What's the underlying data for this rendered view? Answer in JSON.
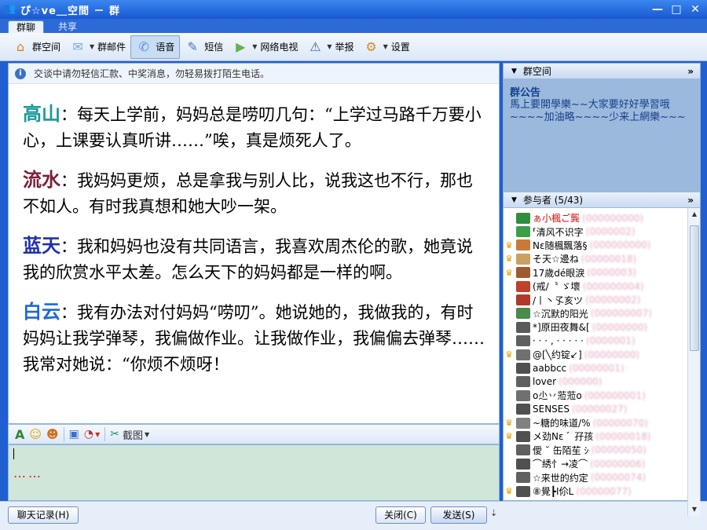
{
  "window": {
    "title": "ぴ☆ve＿空間 － 群",
    "controls": [
      "—",
      "□",
      "✕"
    ]
  },
  "tabs": [
    {
      "label": "群聊",
      "active": true
    },
    {
      "label": "共享",
      "active": false
    }
  ],
  "toolbar": {
    "items": [
      {
        "label": "群空间",
        "icon": "group-space-icon",
        "color": "#d9822b",
        "caret": false,
        "pressed": false
      },
      {
        "label": "群邮件",
        "icon": "mail-icon",
        "color": "#7aa7d8",
        "caret": true,
        "pressed": false
      },
      {
        "label": "语音",
        "icon": "voice-icon",
        "color": "#5d8fd6",
        "caret": false,
        "pressed": true
      },
      {
        "label": "短信",
        "icon": "sms-icon",
        "color": "#4377c2",
        "caret": false,
        "pressed": false
      },
      {
        "label": "网络电视",
        "icon": "tv-icon",
        "color": "#6ab04c",
        "caret": true,
        "pressed": false
      },
      {
        "label": "举报",
        "icon": "report-icon",
        "color": "#355e9e",
        "caret": true,
        "pressed": false
      },
      {
        "label": "设置",
        "icon": "settings-icon",
        "color": "#d48a2a",
        "caret": true,
        "pressed": false
      }
    ]
  },
  "notice": "交谈中请勿轻信汇款、中奖消息，勿轻易拨打陌生电话。",
  "messages": [
    {
      "speaker": "高山",
      "color": "#1a9a9a",
      "text": "：每天上学前，妈妈总是唠叨几句：“上学过马路千万要小心，上课要认真听讲……”唉，真是烦死人了。"
    },
    {
      "speaker": "流水",
      "color": "#7a1f3a",
      "text": "：我妈妈更烦，总是拿我与别人比，说我这也不行，那也不如人。有时我真想和她大吵一架。"
    },
    {
      "speaker": "蓝天",
      "color": "#1f2fb0",
      "text": "：我和妈妈也没有共同语言，我喜欢周杰伦的歌，她竟说我的欣赏水平太差。怎么天下的妈妈都是一样的啊。"
    },
    {
      "speaker": "白云",
      "color": "#1f6ad0",
      "text": "：我有办法对付妈妈“唠叨”。她说她的，我做我的，有时妈妈让我学弹琴，我偏做作业。让我做作业，我偏偏去弹琴……我常对她说：“你烦不烦呀！"
    }
  ],
  "input_tools": {
    "screenshot_label": "截图"
  },
  "input": {
    "draft": "……"
  },
  "buttons": {
    "history": "聊天记录(H)",
    "close": "关闭(C)",
    "send": "发送(S)"
  },
  "group_space": {
    "header": "群空间",
    "announcement_title": "群公告",
    "announcement_text": "馬上要開學樂~~大家要好好學習哦~~~~加油略~~~~少来上網樂~~~"
  },
  "members": {
    "header": "参与者 (5/43)",
    "list": [
      {
        "name": "ぁ小楓ご龔",
        "id": "(000000000)",
        "crown": false,
        "owner": true,
        "color": "#2f8f3f"
      },
      {
        "name": "⸢清风不识字",
        "id": "(0000002)",
        "crown": false,
        "owner": false,
        "color": "#3aa048"
      },
      {
        "name": "Nε随楓飄落§",
        "id": "(000000000)",
        "crown": true,
        "owner": false,
        "color": "#c97a3a"
      },
      {
        "name": "そ天☆邊ね",
        "id": "(00000018)",
        "crown": true,
        "owner": false,
        "color": "#c9a060"
      },
      {
        "name": "17歲dé眼淚",
        "id": "(0000003)",
        "crown": true,
        "owner": false,
        "color": "#a05a30"
      },
      {
        "name": "(戒/〝 ゞ壞",
        "id": "(000000004)",
        "crown": false,
        "owner": false,
        "color": "#c0402a"
      },
      {
        "name": "/丨丶孓亥ツ",
        "id": "(00000002)",
        "crown": false,
        "owner": false,
        "color": "#b03a2a"
      },
      {
        "name": "☆沉默的阳光",
        "id": "(000000007)",
        "crown": false,
        "owner": false,
        "color": "#4a8a4a"
      },
      {
        "name": "*]原田夜舞&[",
        "id": "(00000000)",
        "crown": false,
        "owner": false,
        "color": "#5a5a5a"
      },
      {
        "name": "· · · , · · · · ·",
        "id": "(0000001)",
        "crown": false,
        "owner": false,
        "color": "#606060"
      },
      {
        "name": "@[╲约锭↙]",
        "id": "(00000000)",
        "crown": true,
        "owner": false,
        "color": "#707070"
      },
      {
        "name": "aabbcc",
        "id": "(00000001)",
        "crown": false,
        "owner": false,
        "color": "#505050"
      },
      {
        "name": "lover",
        "id": "(000000)",
        "crown": false,
        "owner": false,
        "color": "#606060"
      },
      {
        "name": "o尐丷蒞蒞o",
        "id": "(000000001)",
        "crown": false,
        "owner": false,
        "color": "#707070"
      },
      {
        "name": "SENSES",
        "id": "(00000027)",
        "crown": false,
        "owner": false,
        "color": "#505050"
      },
      {
        "name": "~糖的味道/%",
        "id": "(00000070)",
        "crown": true,
        "owner": false,
        "color": "#808080"
      },
      {
        "name": "メ劲Nε ﾞ 孖孩",
        "id": "(00000018)",
        "crown": true,
        "owner": false,
        "color": "#505050"
      },
      {
        "name": "僾 ˘ 缶陌苼 ｼ",
        "id": "(00000050)",
        "crown": false,
        "owner": false,
        "color": "#606060"
      },
      {
        "name": "⌒綉忄→凌⌒",
        "id": "(00000006)",
        "crown": false,
        "owner": false,
        "color": "#505050"
      },
      {
        "name": "☆来世的约定",
        "id": "(00000074)",
        "crown": false,
        "owner": false,
        "color": "#606060"
      },
      {
        "name": "⑧覺┣Ι伱L",
        "id": "(00000077)",
        "crown": true,
        "owner": false,
        "color": "#505050"
      }
    ]
  }
}
